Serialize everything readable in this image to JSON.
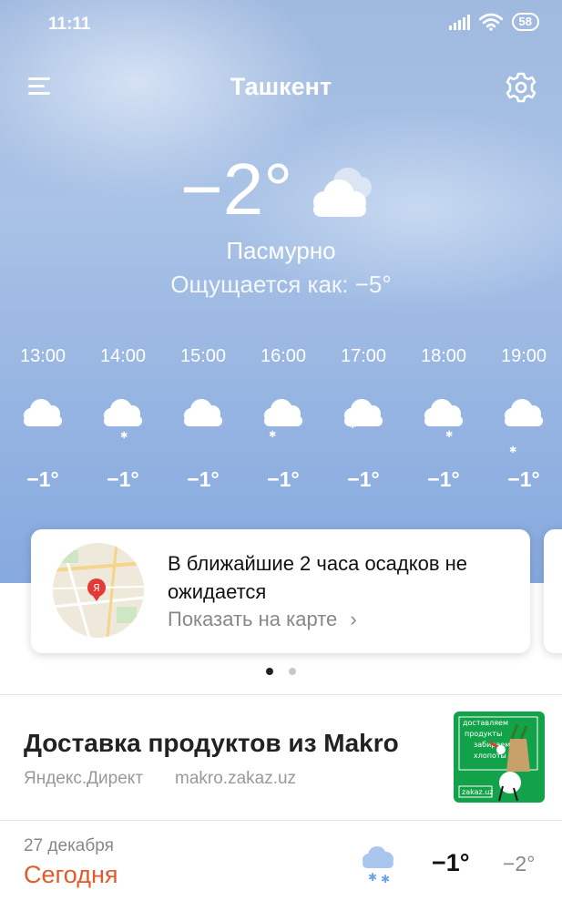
{
  "status_bar": {
    "time": "11:11",
    "battery": "58"
  },
  "header": {
    "city": "Ташкент"
  },
  "current": {
    "temperature": "−2°",
    "condition": "Пасмурно",
    "feels_like": "Ощущается как: −5°",
    "icon": "cloudy-icon"
  },
  "hourly": [
    {
      "time": "13:00",
      "temp": "−1°",
      "icon": "cloud-light-snow-icon"
    },
    {
      "time": "14:00",
      "temp": "−1°",
      "icon": "cloud-light-snow-icon"
    },
    {
      "time": "15:00",
      "temp": "−1°",
      "icon": "cloud-light-snow-icon"
    },
    {
      "time": "16:00",
      "temp": "−1°",
      "icon": "cloud-light-snow-icon"
    },
    {
      "time": "17:00",
      "temp": "−1°",
      "icon": "cloud-light-snow-icon"
    },
    {
      "time": "18:00",
      "temp": "−1°",
      "icon": "cloud-light-snow-icon"
    },
    {
      "time": "19:00",
      "temp": "−1°",
      "icon": "cloud-light-snow-icon"
    }
  ],
  "nowcast_card": {
    "text": "В ближайшие 2 часа осадков не ожидается",
    "link": "Показать на карте",
    "map_marker": "Я"
  },
  "pager": {
    "pages": 2,
    "active": 1
  },
  "ad": {
    "title": "Доставка продуктов из Makro",
    "source": "Яндекс.Директ",
    "domain": "makro.zakaz.uz",
    "image_text": [
      "доставляем",
      "продукты",
      "забираем",
      "хлопоты"
    ],
    "image_logo": "zakaz.uz"
  },
  "forecast_today": {
    "date": "27 декабря",
    "label": "Сегодня",
    "max": "−1°",
    "min": "−2°",
    "icon": "cloud-snow-icon"
  },
  "colors": {
    "accent_today": "#e45a2a",
    "ad_green": "#12a24a",
    "map_marker": "#e53935"
  }
}
